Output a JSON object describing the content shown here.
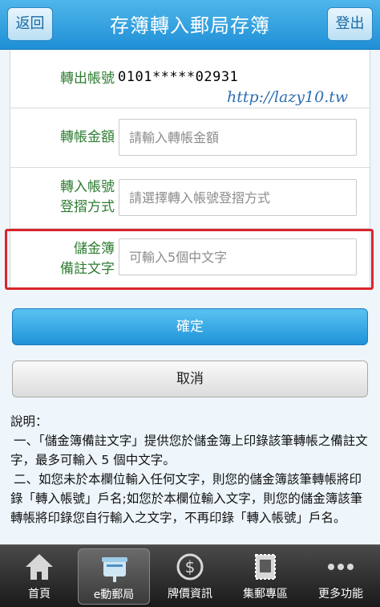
{
  "header": {
    "title": "存簿轉入郵局存簿",
    "back_label": "返回",
    "logout_label": "登出"
  },
  "watermark": "http://lazy10.tw",
  "form": {
    "from_account": {
      "label": "轉出帳號",
      "value": "0101*****02931"
    },
    "amount": {
      "label": "轉帳金額",
      "placeholder": "請輸入轉帳金額"
    },
    "to_account": {
      "label_line1": "轉入帳號",
      "label_line2": "登摺方式",
      "placeholder": "請選擇轉入帳號登摺方式"
    },
    "memo": {
      "label_line1": "儲金簿",
      "label_line2": "備註文字",
      "placeholder": "可輸入5個中文字"
    }
  },
  "buttons": {
    "confirm": "確定",
    "cancel": "取消"
  },
  "notes": {
    "heading": "說明：",
    "line1": "一、「儲金簿備註文字」提供您於儲金簿上印錄該筆轉帳之備註文字，最多可輸入 5 個中文字。",
    "line2": "二、如您未於本欄位輸入任何文字，則您的儲金簿該筆轉帳將印錄「轉入帳號」戶名;如您於本欄位輸入文字，則您的儲金簿該筆轉帳將印錄您自行輸入之文字，不再印錄「轉入帳號」戶名。"
  },
  "bottom_nav": {
    "items": [
      {
        "label": "首頁",
        "icon": "home-icon"
      },
      {
        "label": "e動郵局",
        "icon": "mailbox-icon",
        "active": true
      },
      {
        "label": "牌價資訊",
        "icon": "dollar-coin-icon"
      },
      {
        "label": "集郵專區",
        "icon": "stamp-icon"
      },
      {
        "label": "更多功能",
        "icon": "more-dots-icon"
      }
    ]
  },
  "colors": {
    "header_blue": "#1f8fd6",
    "label_green": "#2e7d32",
    "highlight_red": "#d9262c"
  }
}
